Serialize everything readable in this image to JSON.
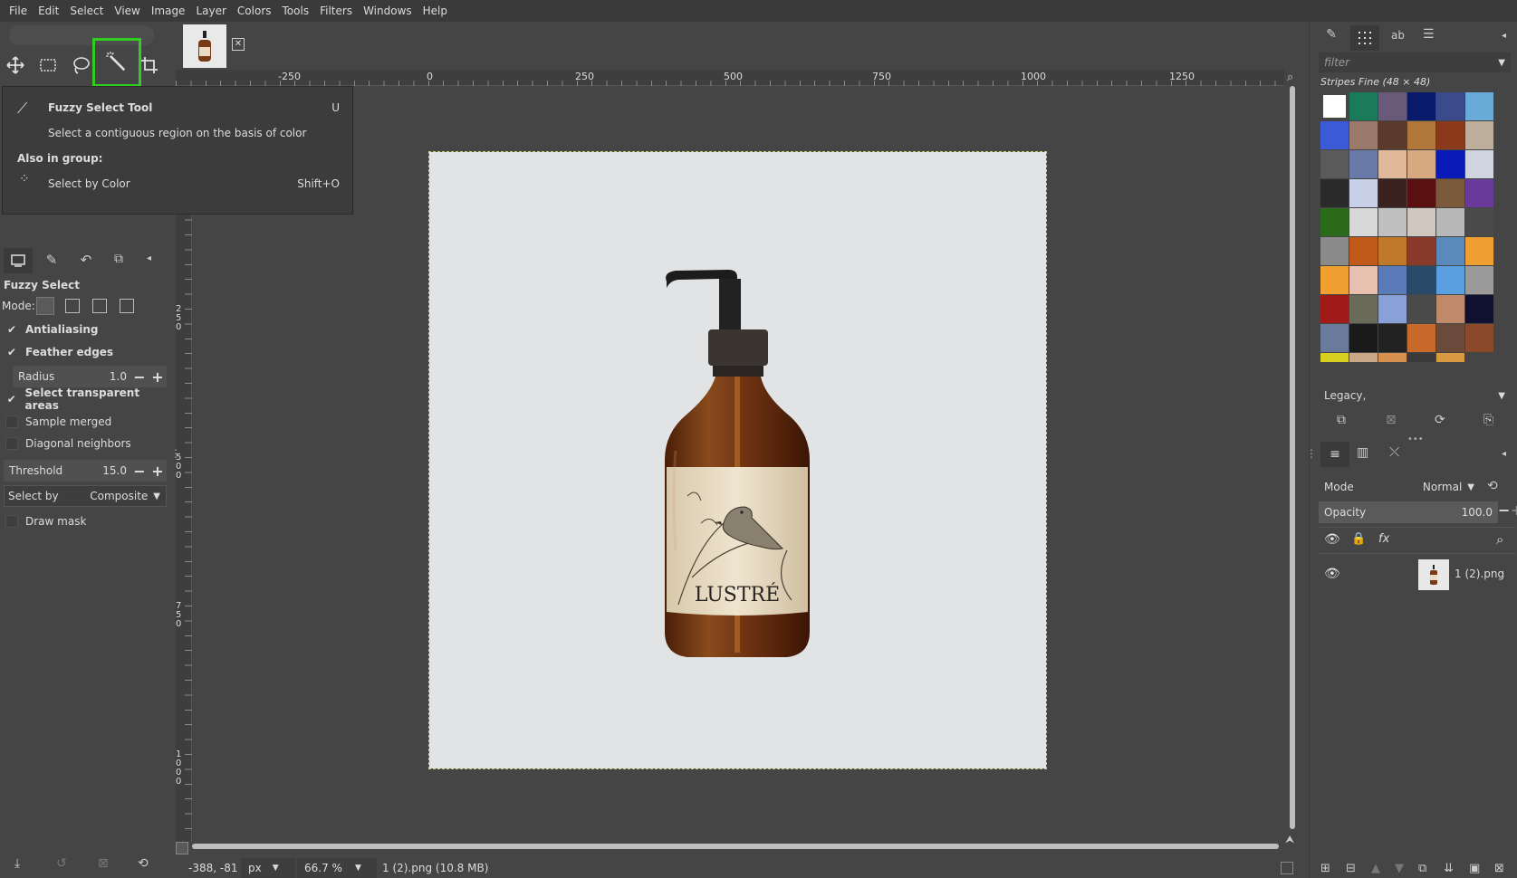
{
  "menubar": {
    "items": [
      "File",
      "Edit",
      "Select",
      "View",
      "Image",
      "Layer",
      "Colors",
      "Tools",
      "Filters",
      "Windows",
      "Help"
    ]
  },
  "toolbox": {
    "tools": [
      {
        "name": "move-tool",
        "icon": "move-icon"
      },
      {
        "name": "rect-select-tool",
        "icon": "rect-select-icon"
      },
      {
        "name": "free-select-tool",
        "icon": "lasso-icon"
      },
      {
        "name": "fuzzy-select-tool",
        "icon": "magic-wand-icon",
        "active": true
      },
      {
        "name": "crop-tool",
        "icon": "crop-icon"
      }
    ]
  },
  "tooltip": {
    "title": "Fuzzy Select Tool",
    "shortcut": "U",
    "description": "Select a contiguous region on the basis of color",
    "also_in_group": "Also in group:",
    "group_item": "Select by Color",
    "group_item_shortcut": "Shift+O"
  },
  "tool_options": {
    "title": "Fuzzy Select",
    "mode_label": "Mode:",
    "antialiasing": {
      "label": "Antialiasing",
      "checked": true
    },
    "feather_edges": {
      "label": "Feather edges",
      "checked": true
    },
    "radius": {
      "label": "Radius",
      "value": "1.0"
    },
    "select_transparent": {
      "label": "Select transparent areas",
      "checked": true
    },
    "sample_merged": {
      "label": "Sample merged",
      "checked": false
    },
    "diagonal_neighbors": {
      "label": "Diagonal neighbors",
      "checked": false
    },
    "threshold": {
      "label": "Threshold",
      "value": "15.0"
    },
    "select_by": {
      "label": "Select by",
      "value": "Composite"
    },
    "draw_mask": {
      "label": "Draw mask",
      "checked": false
    }
  },
  "ruler": {
    "top_labels": [
      "-250",
      "0",
      "250",
      "500",
      "750",
      "1000",
      "1250"
    ],
    "left_labels": [
      "250",
      "500",
      "750",
      "1000"
    ]
  },
  "image_content": {
    "product_label": "LUSTRÉ"
  },
  "statusbar": {
    "coords": "-388, -81",
    "unit": "px",
    "zoom": "66.7 %",
    "file_info": "1 (2).png (10.8 MB)"
  },
  "patterns_panel": {
    "filter_placeholder": "filter",
    "current_pattern": "Stripes Fine (48 × 48)",
    "tag_filter": "Legacy,"
  },
  "layers_panel": {
    "mode_label": "Mode",
    "mode_value": "Normal",
    "opacity_label": "Opacity",
    "opacity_value": "100.0",
    "layer_name": "1 (2).png"
  },
  "colors": {
    "accent_highlight": "#33cc22",
    "bottle_brown": "#7a3a16",
    "label_cream": "#e8dcc4",
    "canvas_bg": "#e2e3e5"
  }
}
